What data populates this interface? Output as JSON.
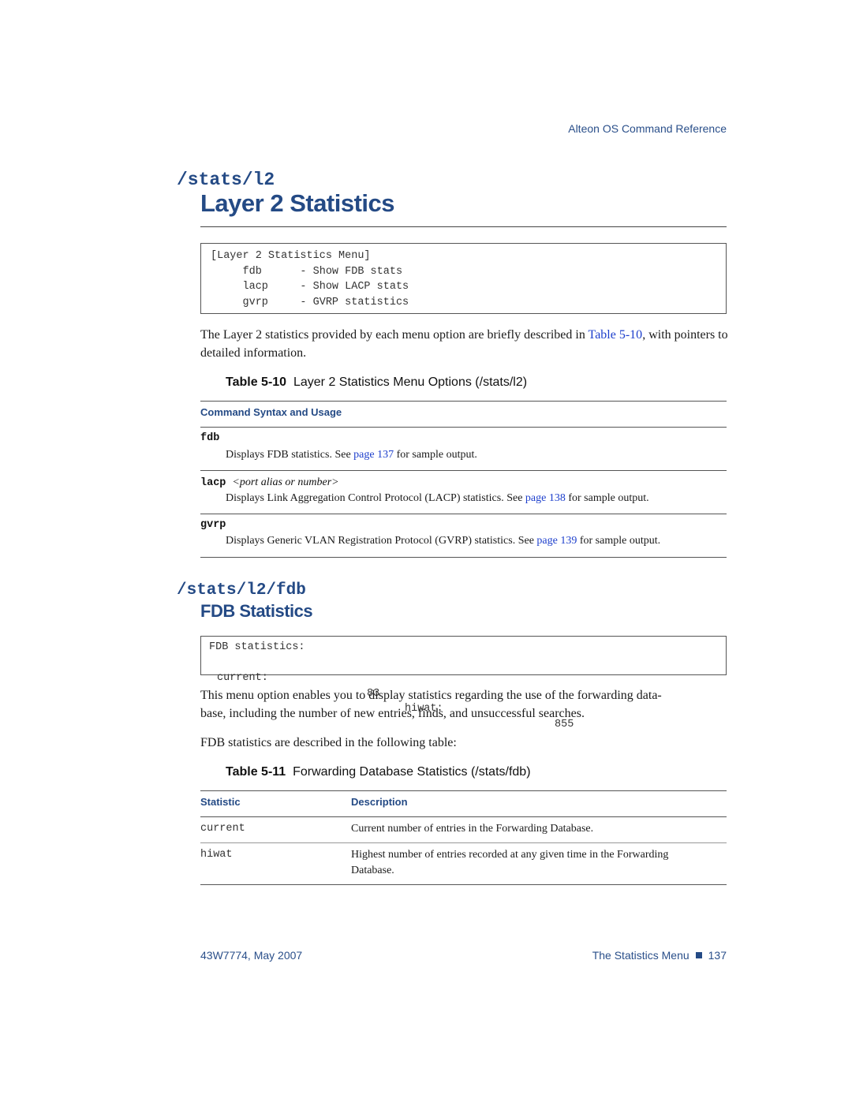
{
  "header": {
    "running_head": "Alteon OS  Command Reference"
  },
  "section1": {
    "command_path": "/stats/l2",
    "title": "Layer 2 Statistics",
    "menu_box": {
      "lines": [
        "[Layer 2 Statistics Menu]",
        "     fdb      - Show FDB stats",
        "     lacp     - Show LACP stats",
        "     gvrp     - GVRP statistics"
      ]
    },
    "intro": {
      "text_before": "The Layer 2 statistics provided by each menu option are briefly described in ",
      "link": "Table 5-10",
      "text_after": ", with pointers to detailed information."
    },
    "table": {
      "caption_number": "Table 5-10",
      "caption_text": "Layer 2 Statistics Menu Options (/stats/l2)",
      "column_header": "Command Syntax and Usage",
      "rows": [
        {
          "command": "fdb",
          "argument": "",
          "desc_before": "Displays FDB statistics. See ",
          "link": "page 137",
          "desc_after": " for sample output."
        },
        {
          "command": "lacp",
          "argument": "<port alias or number>",
          "desc_before": "Displays Link Aggregation Control Protocol (LACP) statistics. See ",
          "link": "page 138",
          "desc_after": " for sample output."
        },
        {
          "command": "gvrp",
          "argument": "",
          "desc_before": "Displays Generic VLAN Registration Protocol (GVRP) statistics. See ",
          "link": "page 139",
          "desc_after": " for sample output."
        }
      ]
    }
  },
  "section2": {
    "command_path": "/stats/l2/fdb",
    "title": "FDB Statistics",
    "output_box": {
      "title_line": "FDB statistics:",
      "current_label": "current:",
      "current_value": "83",
      "hiwat_label": "hiwat:",
      "hiwat_value": "855"
    },
    "para1": "This menu option enables you to display statistics regarding the use of the forwarding data-base, including the number of new entries, finds, and unsuccessful searches.",
    "para1_line1": "This menu option enables you to display statistics regarding the use of the forwarding data-",
    "para1_line2": "base, including the number of new entries, finds, and unsuccessful searches.",
    "para2": "FDB statistics are described in the following table:",
    "table": {
      "caption_number": "Table 5-11",
      "caption_text": "Forwarding Database Statistics (/stats/fdb)",
      "headers": [
        "Statistic",
        "Description"
      ],
      "rows": [
        {
          "statistic": "current",
          "description": "Current number of entries in the Forwarding Database."
        },
        {
          "statistic": "hiwat",
          "description": "Highest number of entries recorded at any given time in the Forwarding Database.",
          "desc_line1": "Highest number of entries recorded at any given time in the Forwarding",
          "desc_line2": "Database."
        }
      ]
    }
  },
  "footer": {
    "doc_id": "43W7774, May 2007",
    "chapter": "The Statistics Menu",
    "page_number": "137"
  },
  "colors": {
    "heading_blue": "#244a85",
    "link_blue": "#1d3fcc"
  }
}
